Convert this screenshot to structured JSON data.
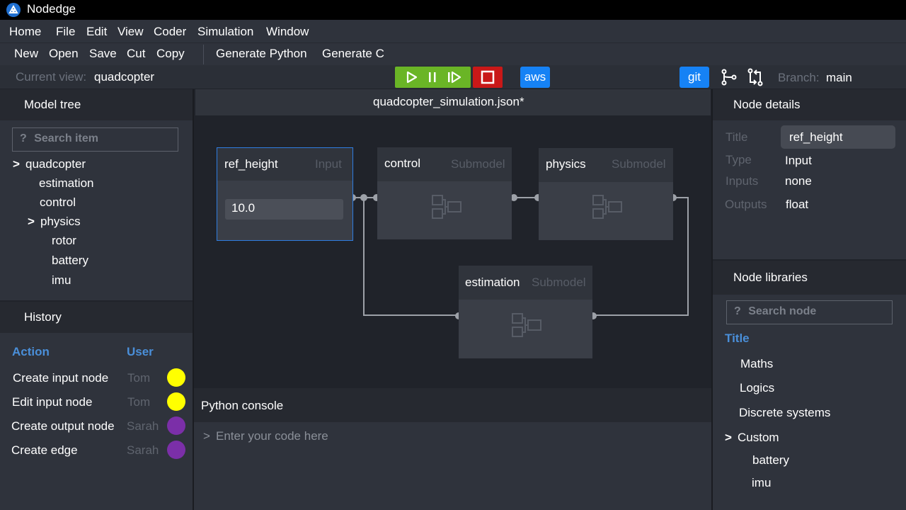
{
  "app": {
    "title": "Nodedge"
  },
  "menu": [
    "Home",
    "File",
    "Edit",
    "View",
    "Coder",
    "Simulation",
    "Window"
  ],
  "toolbar": {
    "new": "New",
    "open": "Open",
    "save": "Save",
    "cut": "Cut",
    "copy": "Copy",
    "gen_python": "Generate Python",
    "gen_c": "Generate C"
  },
  "viewbar": {
    "current_view_label": "Current view:",
    "current_view": "quadcopter",
    "aws": "aws",
    "git": "git",
    "branch_label": "Branch:",
    "branch": "main"
  },
  "model_tree": {
    "header": "Model tree",
    "search_placeholder": "Search item",
    "items": [
      "quadcopter",
      "estimation",
      "control",
      "physics",
      "rotor",
      "battery",
      "imu"
    ]
  },
  "history": {
    "header": "History",
    "col_action": "Action",
    "col_user": "User",
    "rows": [
      {
        "action": "Create input node",
        "user": "Tom",
        "color": "#ffff00"
      },
      {
        "action": "Edit input node",
        "user": "Tom",
        "color": "#ffff00"
      },
      {
        "action": "Create output node",
        "user": "Sarah",
        "color": "#7b2fa8"
      },
      {
        "action": "Create edge",
        "user": "Sarah",
        "color": "#7b2fa8"
      }
    ]
  },
  "editor": {
    "file_tab": "quadcopter_simulation.json*",
    "nodes": {
      "ref_height": {
        "title": "ref_height",
        "type": "Input",
        "value": "10.0"
      },
      "control": {
        "title": "control",
        "type": "Submodel"
      },
      "physics": {
        "title": "physics",
        "type": "Submodel"
      },
      "estimation": {
        "title": "estimation",
        "type": "Submodel"
      }
    }
  },
  "console": {
    "header": "Python console",
    "prompt": ">",
    "placeholder": "Enter your code here"
  },
  "node_details": {
    "header": "Node details",
    "title_label": "Title",
    "title_value": "ref_height",
    "type_label": "Type",
    "type_value": "Input",
    "inputs_label": "Inputs",
    "inputs_value": "none",
    "outputs_label": "Outputs",
    "outputs_value": "float"
  },
  "node_libraries": {
    "header": "Node libraries",
    "search_placeholder": "Search node",
    "title": "Title",
    "items": [
      "Maths",
      "Logics",
      "Discrete systems",
      "Custom",
      "battery",
      "imu"
    ]
  },
  "colors": {
    "accent_blue": "#1682f5",
    "run_green": "#6ab526",
    "stop_red": "#c91818",
    "column_header": "#4a8fd9"
  }
}
